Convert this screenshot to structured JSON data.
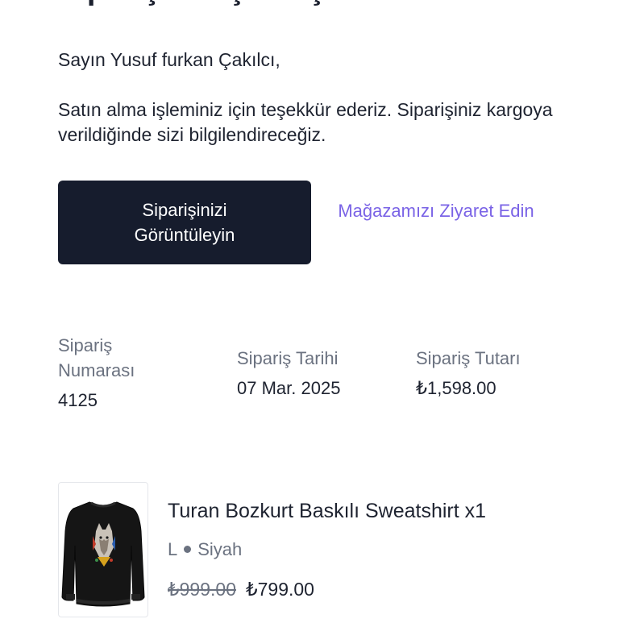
{
  "email": {
    "heading": "Siparişiniz için teşekkür ederiz.",
    "greeting": "Sayın Yusuf furkan Çakılcı,",
    "message": "Satın alma işleminiz için teşekkür ederiz. Siparişiniz kargoya verildiğinde sizi bilgilendireceğiz."
  },
  "actions": {
    "view_order_label": "Siparişinizi Görüntüleyin",
    "visit_store_label": "Mağazamızı Ziyaret Edin"
  },
  "order_info": {
    "number_label": "Sipariş Numarası",
    "number_value": "4125",
    "date_label": "Sipariş Tarihi",
    "date_value": "07 Mar. 2025",
    "total_label": "Sipariş Tutarı",
    "total_value": "₺1,598.00"
  },
  "product": {
    "title": "Turan Bozkurt Baskılı Sweatshirt x1",
    "size": "L",
    "color": "Siyah",
    "original_price": "₺999.00",
    "price": "₺799.00",
    "image_icon": "black-sweatshirt-with-wolf-print"
  },
  "colors": {
    "primary_button_bg": "#161c2d",
    "link": "#7a63e6",
    "muted_text": "#6b7280"
  }
}
